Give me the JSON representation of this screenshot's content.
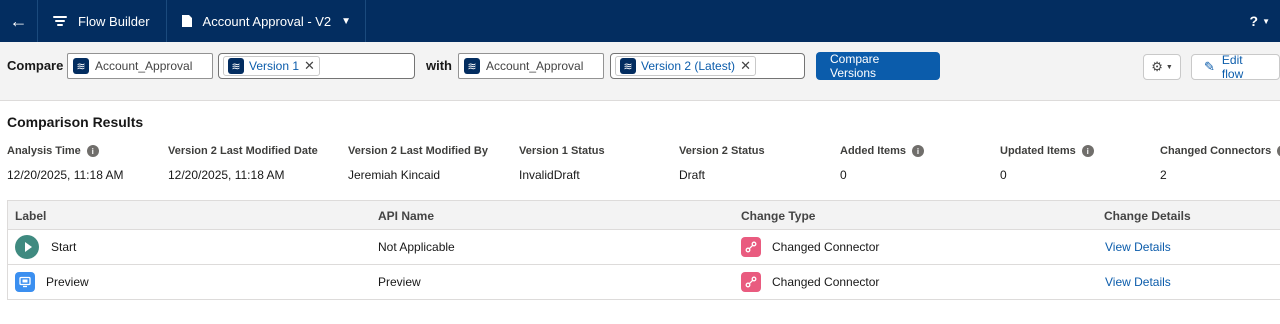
{
  "nav": {
    "app_name": "Flow Builder",
    "tab_title": "Account Approval - V2",
    "help_label": "?"
  },
  "compare": {
    "compare_label": "Compare",
    "with_label": "with",
    "flow_left": "Account_Approval",
    "version_left": "Version 1",
    "flow_right": "Account_Approval",
    "version_right": "Version 2 (Latest)",
    "compare_button": "Compare Versions",
    "edit_button": "Edit flow"
  },
  "results": {
    "title": "Comparison Results",
    "columns": [
      {
        "header": "Analysis Time",
        "value": "12/20/2025, 11:18 AM",
        "info": true
      },
      {
        "header": "Version 2 Last Modified Date",
        "value": "12/20/2025, 11:18 AM",
        "info": false
      },
      {
        "header": "Version 2 Last Modified By",
        "value": "Jeremiah Kincaid",
        "info": false
      },
      {
        "header": "Version 1 Status",
        "value": "InvalidDraft",
        "info": false
      },
      {
        "header": "Version 2 Status",
        "value": "Draft",
        "info": false
      },
      {
        "header": "Added Items",
        "value": "0",
        "info": true
      },
      {
        "header": "Updated Items",
        "value": "0",
        "info": true
      },
      {
        "header": "Changed Connectors",
        "value": "2",
        "info": true
      }
    ]
  },
  "table": {
    "headers": [
      "Label",
      "API Name",
      "Change Type",
      "Change Details"
    ],
    "rows": [
      {
        "label": "Start",
        "api_name": "Not Applicable",
        "change_type": "Changed Connector",
        "details": "View Details",
        "icon": "start-icon"
      },
      {
        "label": "Preview",
        "api_name": "Preview",
        "change_type": "Changed Connector",
        "details": "View Details",
        "icon": "screen-icon"
      }
    ]
  },
  "colors": {
    "nav_bg": "#032d60",
    "brand_blue": "#0b5cab",
    "start_green": "#3f8a80",
    "screen_blue": "#3b8ff0",
    "connector_pink": "#e95b7f"
  }
}
